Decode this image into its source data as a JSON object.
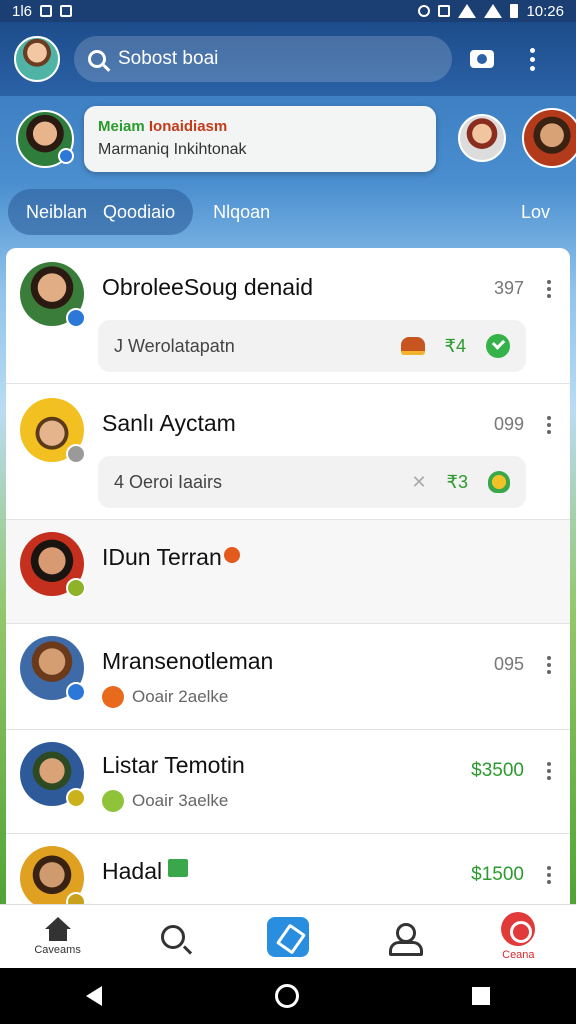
{
  "status_bar": {
    "time_left": "1Ɩ6",
    "time_right": "10:26"
  },
  "search": {
    "placeholder": "Sobost boai"
  },
  "notification": {
    "title_green": "Meiam",
    "title_red": "Ionaidiasm",
    "subtitle": "Marmaniq Inkihtonak"
  },
  "filters": {
    "active_a": "Neiblan",
    "active_b": "Qoodiaio",
    "chip_2": "Nlqoan",
    "chip_right": "Lov"
  },
  "rows": [
    {
      "name": "ObroleeSoug denaid",
      "value": "397",
      "sub_text": "J Werolatapatn",
      "sub_count": "₹4",
      "avatar_color": "#2b78d8"
    },
    {
      "name": "Sanlı Ayctam",
      "value": "099",
      "sub_text": "4 Oeroi Iaairs",
      "sub_count": "₹3",
      "avatar_color": "#9a9a9a"
    },
    {
      "name": "IDun Terran",
      "value": "",
      "sub_text": "",
      "sub_count": "",
      "avatar_color": "#8fb228"
    },
    {
      "name": "Mransenotleman",
      "value": "095",
      "sub_text": "Ooair 2aelke",
      "sub_count": "",
      "avatar_color": "#2b78d8"
    },
    {
      "name": "Listar Temotin",
      "value": "$3500",
      "sub_text": "Ooair 3aelke",
      "sub_count": "",
      "avatar_color": "#c9b21c"
    },
    {
      "name": "Hadal",
      "value": "$1500",
      "sub_text": "",
      "sub_count": "",
      "avatar_color": "#c9a21c"
    }
  ],
  "bottom_nav": {
    "home_label": "Caveams",
    "alert_label": "Ceana"
  },
  "colors": {
    "accent": "#2a62a6",
    "money": "#2a9b2c"
  }
}
